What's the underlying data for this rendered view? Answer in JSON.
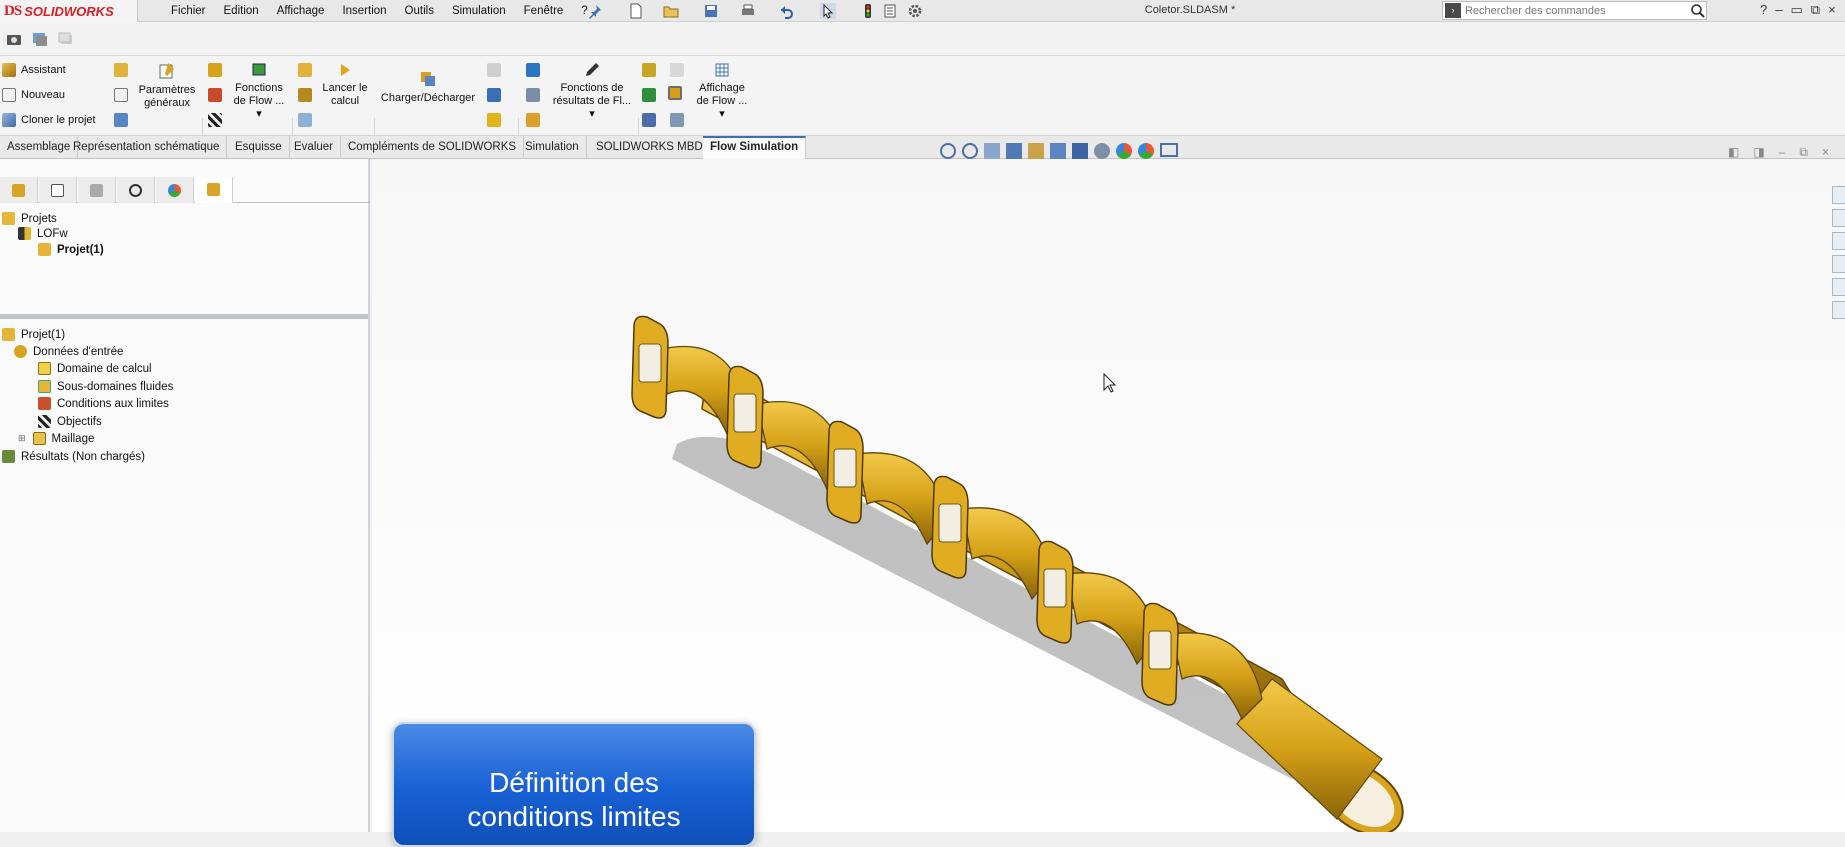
{
  "app": {
    "brand_prefix": "DS",
    "brand_name": "SOLIDWORKS",
    "document_title": "Coletor.SLDASM *"
  },
  "menu": [
    "Fichier",
    "Edition",
    "Affichage",
    "Insertion",
    "Outils",
    "Simulation",
    "Fenêtre",
    "?"
  ],
  "search": {
    "placeholder": "Rechercher des commandes"
  },
  "ribbon": {
    "assistant": "Assistant",
    "nouveau": "Nouveau",
    "cloner": "Cloner le projet",
    "parametres_1": "Paramètres",
    "parametres_2": "généraux",
    "fonctions_flow_1": "Fonctions",
    "fonctions_flow_2": "de Flow ...",
    "lancer_1": "Lancer le",
    "lancer_2": "calcul",
    "charger": "Charger/Décharger",
    "fonctions_res_1": "Fonctions de",
    "fonctions_res_2": "résultats de Fl...",
    "affichage_1": "Affichage",
    "affichage_2": "de Flow ..."
  },
  "tabs": [
    "Assemblage",
    "Représentation schématique",
    "Esquisse",
    "Evaluer",
    "Compléments de SOLIDWORKS",
    "Simulation",
    "SOLIDWORKS MBD",
    "Flow Simulation"
  ],
  "active_tab": "Flow Simulation",
  "projects_tree": {
    "root": "Projets",
    "group": "LOFw",
    "project": "Projet(1)"
  },
  "analysis_tree": {
    "root": "Projet(1)",
    "input": "Données d'entrée",
    "items": [
      "Domaine de calcul",
      "Sous-domaines fluides",
      "Conditions aux limites",
      "Objectifs",
      "Maillage"
    ],
    "results": "Résultats (Non chargés)"
  },
  "banner": {
    "line1": "Définition des",
    "line2": "conditions limites"
  },
  "colors": {
    "accent": "#1760d4",
    "part_gold": "#d4a117",
    "brand_red": "#d81e26"
  }
}
